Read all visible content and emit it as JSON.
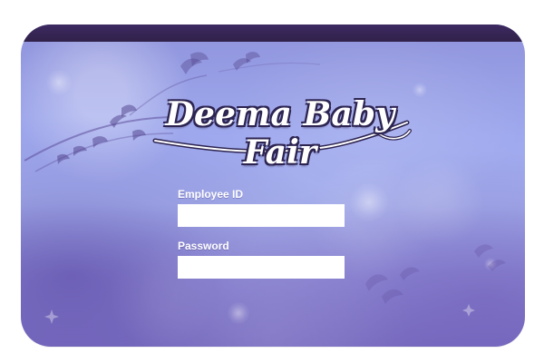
{
  "app": {
    "logo_text": "Deema Baby Fair"
  },
  "login": {
    "employee_id_label": "Employee ID",
    "employee_id_value": "",
    "employee_id_placeholder": "",
    "password_label": "Password",
    "password_value": "",
    "password_placeholder": ""
  },
  "theme": {
    "top_bar": "#302149",
    "card_light": "#a3adec",
    "card_dark": "#7a6fc3",
    "label": "#ffffff",
    "input_bg": "#ffffff"
  },
  "icons": [
    "floral-decoration-icon",
    "bubble-decoration-icon",
    "logo-swoosh-icon"
  ]
}
